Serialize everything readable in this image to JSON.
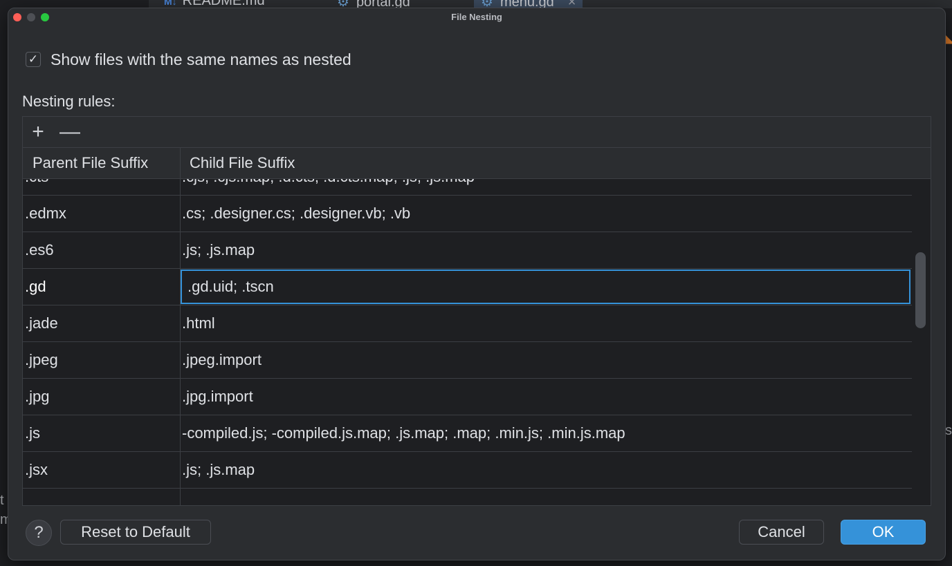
{
  "background": {
    "tabs": [
      {
        "icon": "M↓",
        "label": "README.md"
      },
      {
        "icon": "gd-icon",
        "label": "portal.gd"
      },
      {
        "icon": "gd-icon",
        "label": "menu.gd",
        "close": "×"
      }
    ],
    "left_text": [
      "t",
      "m"
    ],
    "right_text": "s"
  },
  "dialog": {
    "title": "File Nesting",
    "show_same_names": {
      "checked": true,
      "check_glyph": "✓",
      "label": "Show files with the same names as nested"
    },
    "rules_label": "Nesting rules:",
    "toolbar": {
      "add": "+",
      "remove": "—"
    },
    "columns": {
      "parent": "Parent File Suffix",
      "child": "Child File Suffix"
    },
    "rows": [
      {
        "parent": ".cts",
        "child": ".cjs; .cjs.map; .d.cts; .d.cts.map; .js; .js.map"
      },
      {
        "parent": ".edmx",
        "child": ".cs; .designer.cs; .designer.vb; .vb"
      },
      {
        "parent": ".es6",
        "child": ".js; .js.map"
      },
      {
        "parent": ".gd",
        "child": ".gd.uid; .tscn",
        "selected": true
      },
      {
        "parent": ".jade",
        "child": ".html"
      },
      {
        "parent": ".jpeg",
        "child": ".jpeg.import"
      },
      {
        "parent": ".jpg",
        "child": ".jpg.import"
      },
      {
        "parent": ".js",
        "child": "-compiled.js; -compiled.js.map; .js.map; .map; .min.js; .min.js.map"
      },
      {
        "parent": ".jsx",
        "child": ".js; .js.map"
      },
      {
        "parent": ".",
        "child": ""
      }
    ],
    "footer": {
      "help": "?",
      "reset": "Reset to Default",
      "cancel": "Cancel",
      "ok": "OK"
    }
  },
  "colors": {
    "accent": "#3592d9",
    "dialog_bg": "#2b2d30",
    "table_bg": "#1e1f22",
    "close": "#ff5f57",
    "maximize": "#28c840"
  }
}
